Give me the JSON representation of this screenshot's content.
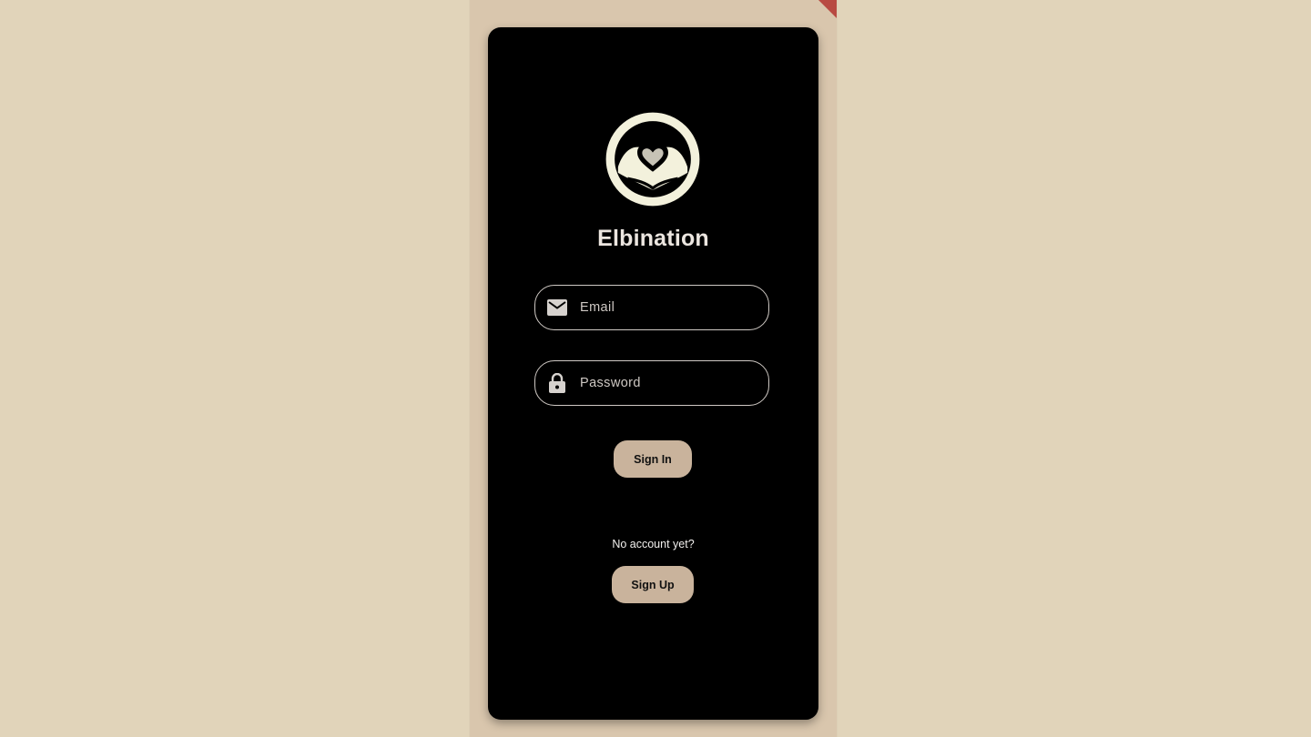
{
  "app": {
    "title": "Elbination",
    "logo_icon": "heart-hands-logo"
  },
  "login": {
    "email": {
      "icon": "mail-icon",
      "placeholder": "Email",
      "value": ""
    },
    "password": {
      "icon": "lock-icon",
      "placeholder": "Password",
      "value": ""
    },
    "sign_in_label": "Sign In",
    "no_account_text": "No account yet?",
    "sign_up_label": "Sign Up"
  },
  "colors": {
    "page_background": "#e1d4ba",
    "card_background": "#000000",
    "button_background": "#c9b39c",
    "logo_color": "#f3f1dc",
    "debug_banner": "#b84a42"
  }
}
